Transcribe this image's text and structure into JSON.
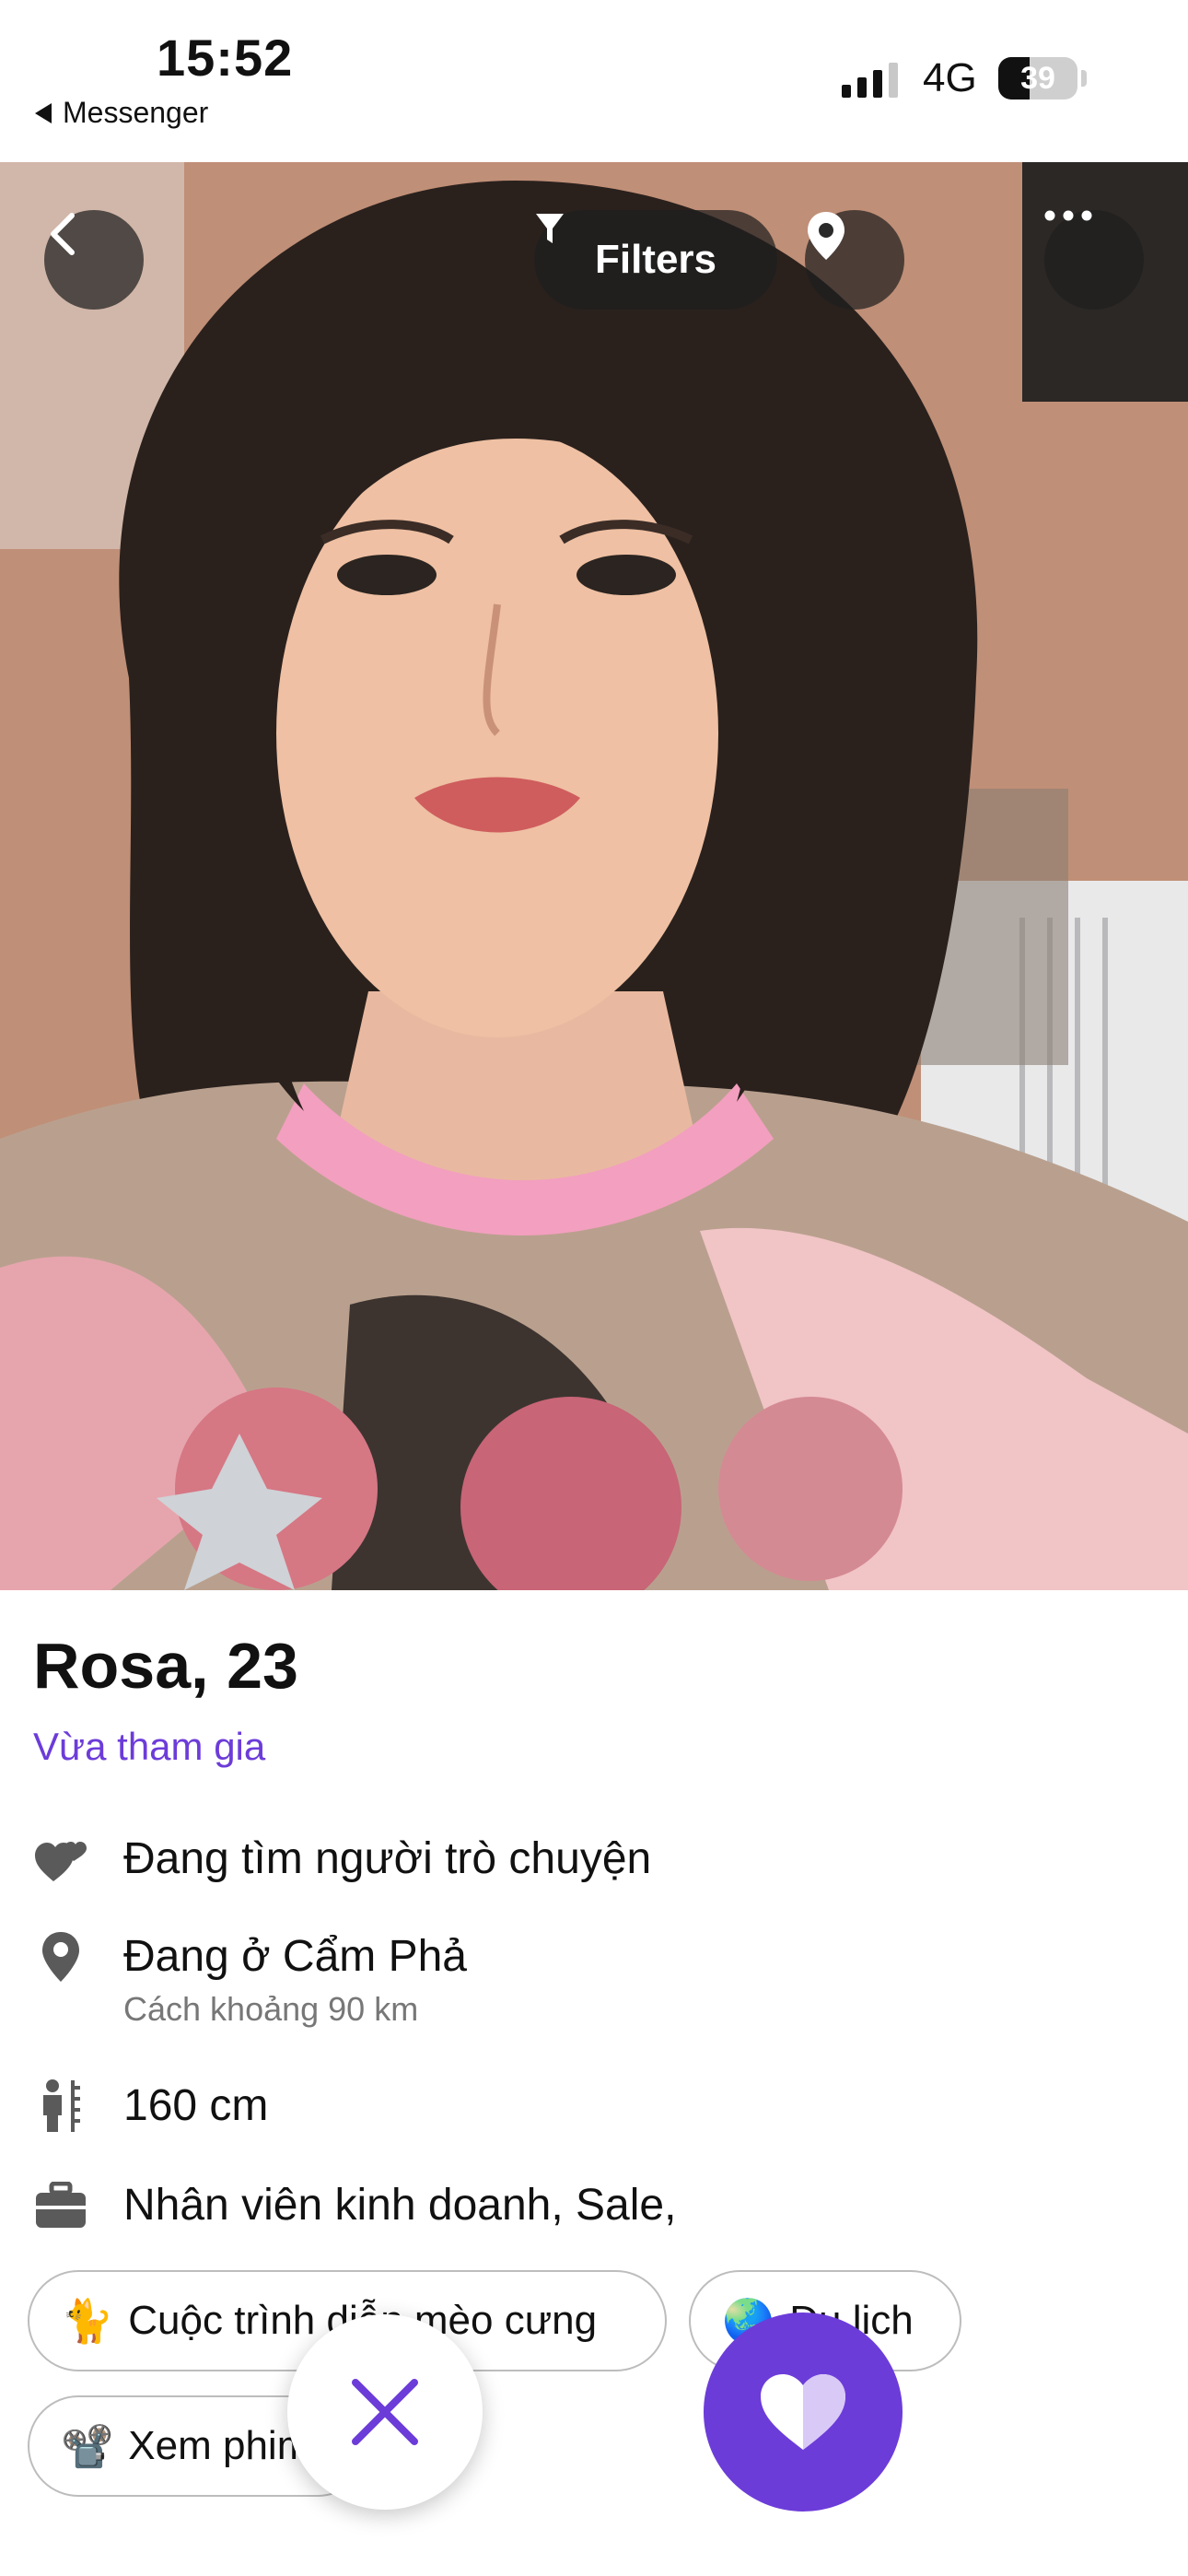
{
  "status_bar": {
    "time": "15:52",
    "back_app": "Messenger",
    "network": "4G",
    "battery": "39",
    "battery_level": 0.39
  },
  "top_controls": {
    "filters_label": "Filters"
  },
  "profile": {
    "name_age": "Rosa, 23",
    "joined": "Vừa tham gia",
    "details": {
      "looking_for": "Đang tìm người trò chuyện",
      "location": "Đang ở Cẩm Phả",
      "distance": "Cách  khoảng 90 km",
      "height": "160 cm",
      "job": "Nhân viên kinh doanh, Sale,"
    },
    "interests": [
      {
        "emoji": "🐈",
        "label": "Cuộc trình diễn mèo cưng"
      },
      {
        "emoji": "🌏",
        "label": "Du lịch"
      },
      {
        "emoji": "📽️",
        "label": "Xem phim"
      }
    ]
  },
  "colors": {
    "accent": "#6c3cd9",
    "overlay_button": "#1e1e1e"
  },
  "icons": [
    "chevron-left-icon",
    "filter-icon",
    "location-pin-icon",
    "more-icon",
    "hearts-icon",
    "ruler-person-icon",
    "briefcase-icon",
    "close-icon",
    "heart-icon"
  ]
}
